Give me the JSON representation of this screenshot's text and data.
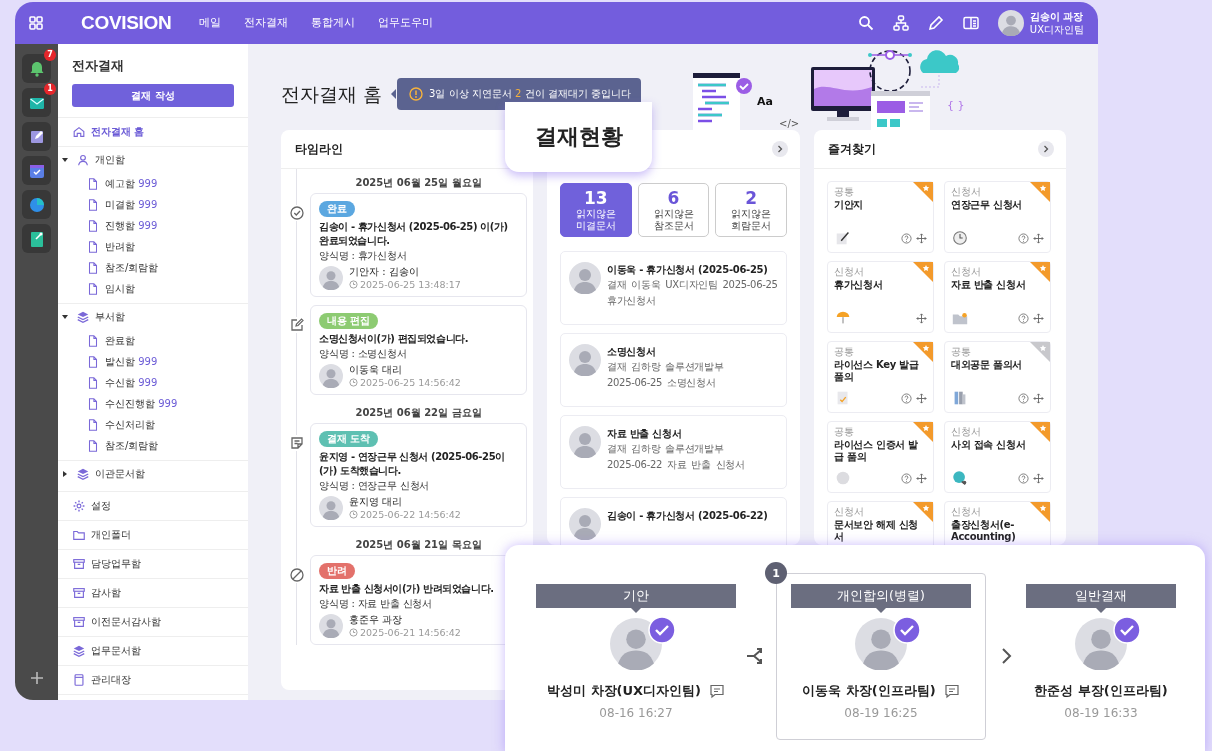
{
  "top_bar": {
    "logo": "COVISION",
    "menu": [
      "메일",
      "전자결재",
      "통합게시",
      "업무도우미"
    ],
    "user": {
      "name": "김송이 과장",
      "team": "UX디자인팀"
    }
  },
  "rail": {
    "items": [
      {
        "kind": "bell",
        "badge": "7"
      },
      {
        "kind": "mail",
        "badge": "1"
      },
      {
        "kind": "note"
      },
      {
        "kind": "calendar"
      },
      {
        "kind": "chart"
      },
      {
        "kind": "memo"
      }
    ]
  },
  "sidebar": {
    "title": "전자결재",
    "compose_button": "결재 작성",
    "home": {
      "label": "전자결재 홈",
      "selected": true
    },
    "groups": [
      {
        "label": "개인함",
        "kind": "person",
        "expanded": true,
        "children": [
          {
            "label": "예고함",
            "count": "999"
          },
          {
            "label": "미결함",
            "count": "999"
          },
          {
            "label": "진행함",
            "count": "999"
          },
          {
            "label": "반려함"
          },
          {
            "label": "참조/회람함"
          },
          {
            "label": "임시함"
          }
        ]
      },
      {
        "label": "부서함",
        "kind": "stack",
        "expanded": true,
        "children": [
          {
            "label": "완료함"
          },
          {
            "label": "발신함",
            "count": "999"
          },
          {
            "label": "수신함",
            "count": "999"
          },
          {
            "label": "수신진행함",
            "count": "999"
          },
          {
            "label": "수신처리함"
          },
          {
            "label": "참조/회람함"
          }
        ]
      },
      {
        "label": "이관문서함",
        "kind": "stack",
        "expanded": false
      }
    ],
    "links": [
      {
        "label": "설정",
        "kind": "gear"
      },
      {
        "label": "개인폴더",
        "kind": "folder"
      },
      {
        "label": "담당업무함",
        "kind": "box"
      },
      {
        "label": "감사함",
        "kind": "box"
      },
      {
        "label": "이전문서감사함",
        "kind": "box"
      },
      {
        "label": "업무문서함",
        "kind": "stack"
      },
      {
        "label": "관리대장",
        "kind": "ledger"
      }
    ]
  },
  "page_title": "전자결재 홈",
  "notice": {
    "prefix": "3일 이상 지연문서",
    "count": "2",
    "suffix": "건이 결재대기 중입니다"
  },
  "illustration": {
    "labels": [
      "Aa",
      "</>",
      "{ }"
    ]
  },
  "timeline": {
    "title": "타임라인",
    "days": [
      {
        "date": "2025년 06월 25일 월요일",
        "events": [
          {
            "kind": "done",
            "status": "완료",
            "color": "#5ba7e0",
            "title": "김송이 - 휴가신청서 (2025-06-25) 이(가) 완료되었습니다.",
            "form": "양식명 : 휴가신청서",
            "person": "기안자 : 김송이",
            "time": "2025-06-25 13:48:17"
          },
          {
            "kind": "edit",
            "status": "내용 편집",
            "color": "#8dcb72",
            "title": "소명신청서이(가) 편집되었습니다.",
            "form": "양식명 : 소명신청서",
            "person": "이동욱 대리",
            "time": "2025-06-25 14:56:42"
          }
        ]
      },
      {
        "date": "2025년 06월 22일 금요일",
        "events": [
          {
            "kind": "arrive",
            "status": "결재 도착",
            "color": "#5ec0b2",
            "title": "윤지영 - 연장근무 신청서 (2025-06-25이(가) 도착했습니다.",
            "form": "양식명 : 연장근무 신청서",
            "person": "윤지영 대리",
            "time": "2025-06-22 14:56:42"
          }
        ]
      },
      {
        "date": "2025년 06월 21일 목요일",
        "events": [
          {
            "kind": "reject",
            "status": "반려",
            "color": "#e3716b",
            "title": "자료 반출 신청서이(가) 반려되었습니다.",
            "form": "양식명 : 자료 반출 신청서",
            "person": "홍준우 과장",
            "time": "2025-06-21 14:56:42"
          }
        ]
      }
    ]
  },
  "approval_status": {
    "callout": "결재현황",
    "tabs": [
      {
        "count": "13",
        "label": "읽지않은 미결문서",
        "selected": true
      },
      {
        "count": "6",
        "label": "읽지않은 참조문서",
        "selected": false
      },
      {
        "count": "2",
        "label": "읽지않은 회람문서",
        "selected": false
      }
    ],
    "items": [
      {
        "title": "이동욱 - 휴가신청서 (2025-06-25)",
        "lines": [
          "결재 이동욱 UX디자인팀 2025-06-25",
          "휴가신청서"
        ]
      },
      {
        "title": "소명신청서",
        "lines": [
          "결재 김하랑 솔루션개발부",
          "2025-06-25 소명신청서"
        ]
      },
      {
        "title": "자료 반출 신청서",
        "lines": [
          "결재 김하랑 솔루션개발부",
          "2025-06-22 자료 반출 신청서"
        ]
      },
      {
        "title": "김송이 - 휴가신청서 (2025-06-22)"
      }
    ]
  },
  "favorites": {
    "title": "즐겨찾기",
    "items": [
      {
        "category": "공통",
        "name": "기안지",
        "kind": "pen",
        "help": true,
        "starred": true
      },
      {
        "category": "신청서",
        "name": "연장근무 신청서",
        "kind": "clock",
        "help": true,
        "starred": true
      },
      {
        "category": "신청서",
        "name": "휴가신청서",
        "kind": "umbrella",
        "help": false,
        "starred": true
      },
      {
        "category": "신청서",
        "name": "자료 반출 신청서",
        "kind": "folder",
        "help": true,
        "starred": true
      },
      {
        "category": "공통",
        "name": "라이선스 Key 발급 품의",
        "kind": "document",
        "help": true,
        "starred": true
      },
      {
        "category": "공통",
        "name": "대외공문 품의서",
        "kind": "binder",
        "help": true,
        "starred": false
      },
      {
        "category": "공통",
        "name": "라이선스 인증서 발급 품의",
        "kind": "ball",
        "help": true,
        "starred": true
      },
      {
        "category": "신청서",
        "name": "사외 접속 신청서",
        "kind": "globe",
        "help": true,
        "starred": true
      },
      {
        "category": "신청서",
        "name": "문서보안 해제 신청서",
        "starred": true
      },
      {
        "category": "신청서",
        "name": "출장신청서(e-Accounting)",
        "starred": true
      }
    ]
  },
  "approval_line": {
    "steps": [
      {
        "role": "기안",
        "name": "박성미 차장(UX디자인팀)",
        "time": "08-16 16:27",
        "approved": true,
        "comment": true,
        "highlighted": false
      },
      {
        "order": "1",
        "role": "개인합의(병렬)",
        "name": "이동욱 차장(인프라팀)",
        "time": "08-19 16:25",
        "approved": true,
        "comment": true,
        "highlighted": true
      },
      {
        "role": "일반결재",
        "name": "한준성 부장(인프라팀)",
        "time": "08-19 16:33",
        "approved": true,
        "comment": false,
        "highlighted": false
      }
    ],
    "connectors": [
      {
        "kind": "branch"
      },
      {
        "kind": "next"
      }
    ]
  }
}
